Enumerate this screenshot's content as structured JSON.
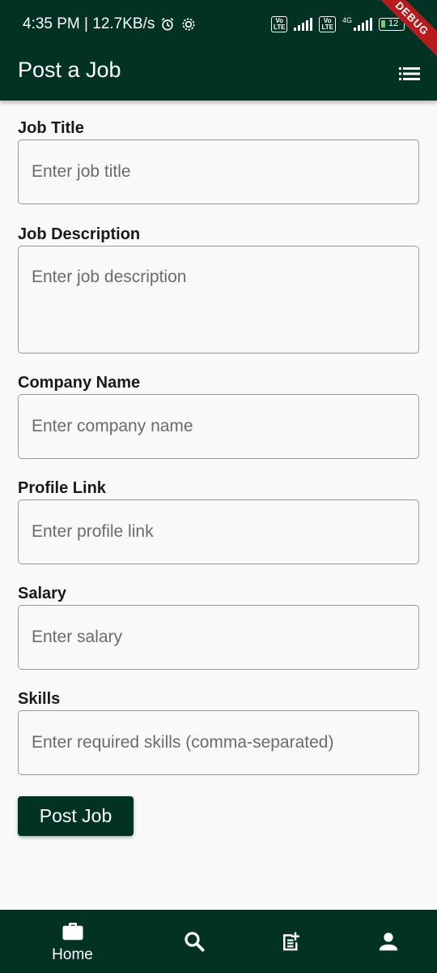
{
  "status_bar": {
    "time_speed": "4:35 PM | 12.7KB/s",
    "network": "4G",
    "battery": "12",
    "volte": "Vo LTE"
  },
  "debug_label": "DEBUG",
  "app_bar": {
    "title": "Post a Job",
    "menu_icon": "list-icon"
  },
  "form": {
    "job_title": {
      "label": "Job Title",
      "placeholder": "Enter job title"
    },
    "job_description": {
      "label": "Job Description",
      "placeholder": "Enter job description"
    },
    "company_name": {
      "label": "Company Name",
      "placeholder": "Enter company name"
    },
    "profile_link": {
      "label": "Profile Link",
      "placeholder": "Enter profile link"
    },
    "salary": {
      "label": "Salary",
      "placeholder": "Enter salary"
    },
    "skills": {
      "label": "Skills",
      "placeholder": "Enter required skills (comma-separated)"
    }
  },
  "submit_label": "Post Job",
  "bottom_nav": {
    "home_label": "Home",
    "icons": [
      "briefcase-icon",
      "search-icon",
      "post-add-icon",
      "person-icon"
    ]
  },
  "colors": {
    "primary": "#023224",
    "background": "#f9f9f9",
    "debug": "#b71c1c"
  }
}
